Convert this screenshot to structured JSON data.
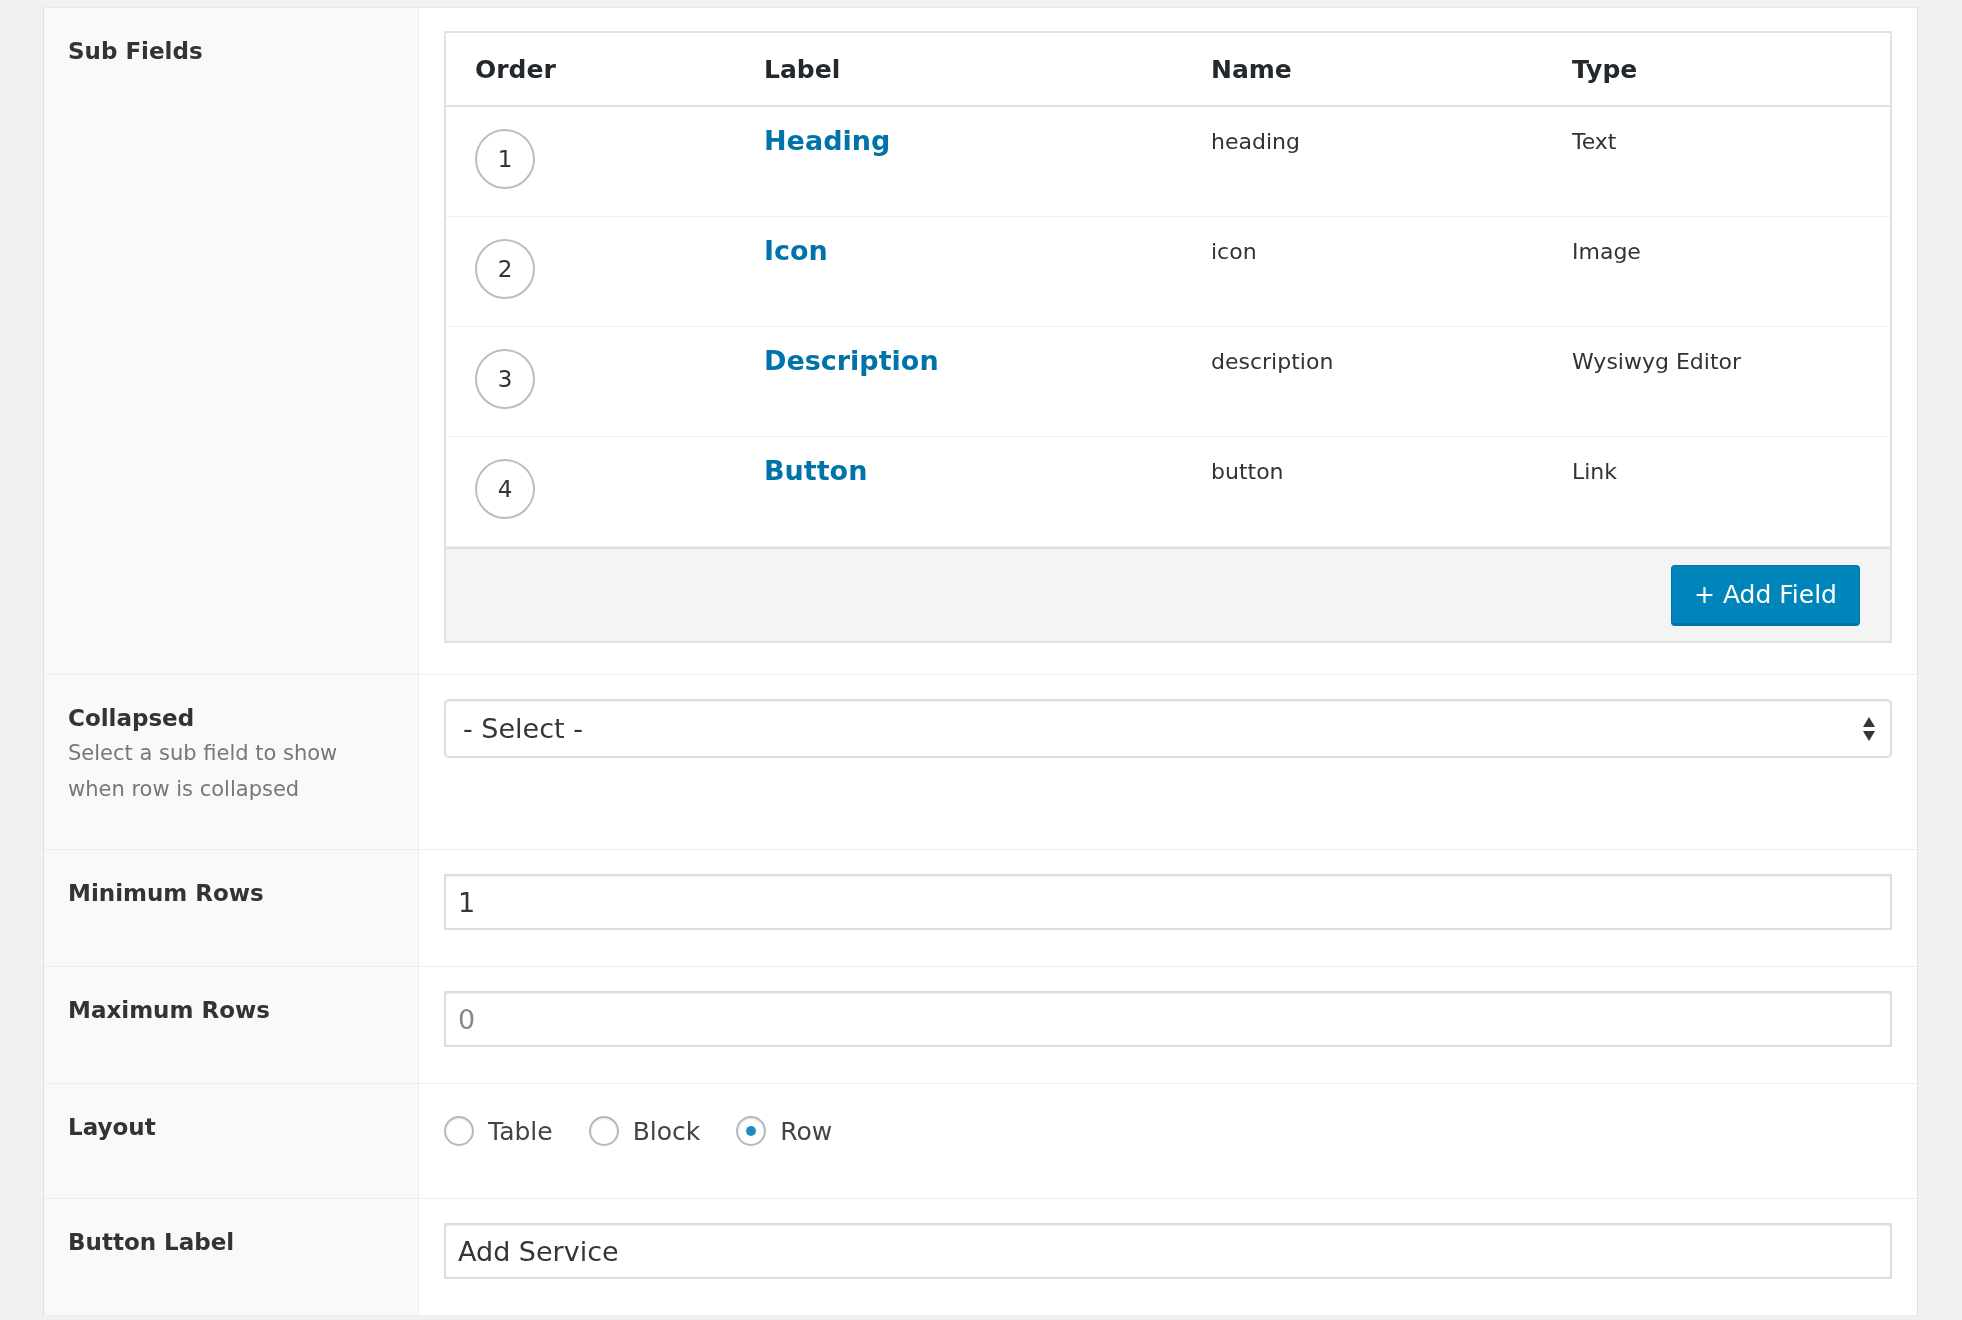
{
  "settings": [
    {
      "kind": "subfields",
      "label": "Sub Fields",
      "table": {
        "columns": [
          "Order",
          "Label",
          "Name",
          "Type"
        ],
        "rows": [
          {
            "order": "1",
            "label": "Heading",
            "name": "heading",
            "type": "Text"
          },
          {
            "order": "2",
            "label": "Icon",
            "name": "icon",
            "type": "Image"
          },
          {
            "order": "3",
            "label": "Description",
            "name": "description",
            "type": "Wysiwyg Editor"
          },
          {
            "order": "4",
            "label": "Button",
            "name": "button",
            "type": "Link"
          }
        ],
        "add_button": "+ Add Field"
      }
    },
    {
      "kind": "select",
      "label": "Collapsed",
      "description": "Select a sub field to show when row is collapsed",
      "value": "- Select -"
    },
    {
      "kind": "input",
      "label": "Minimum Rows",
      "value": "1"
    },
    {
      "kind": "input",
      "label": "Maximum Rows",
      "placeholder": "0"
    },
    {
      "kind": "radio",
      "label": "Layout",
      "options": [
        {
          "label": "Table",
          "selected": false
        },
        {
          "label": "Block",
          "selected": false
        },
        {
          "label": "Row",
          "selected": true
        }
      ]
    },
    {
      "kind": "input",
      "label": "Button Label",
      "value": "Add Service"
    }
  ]
}
